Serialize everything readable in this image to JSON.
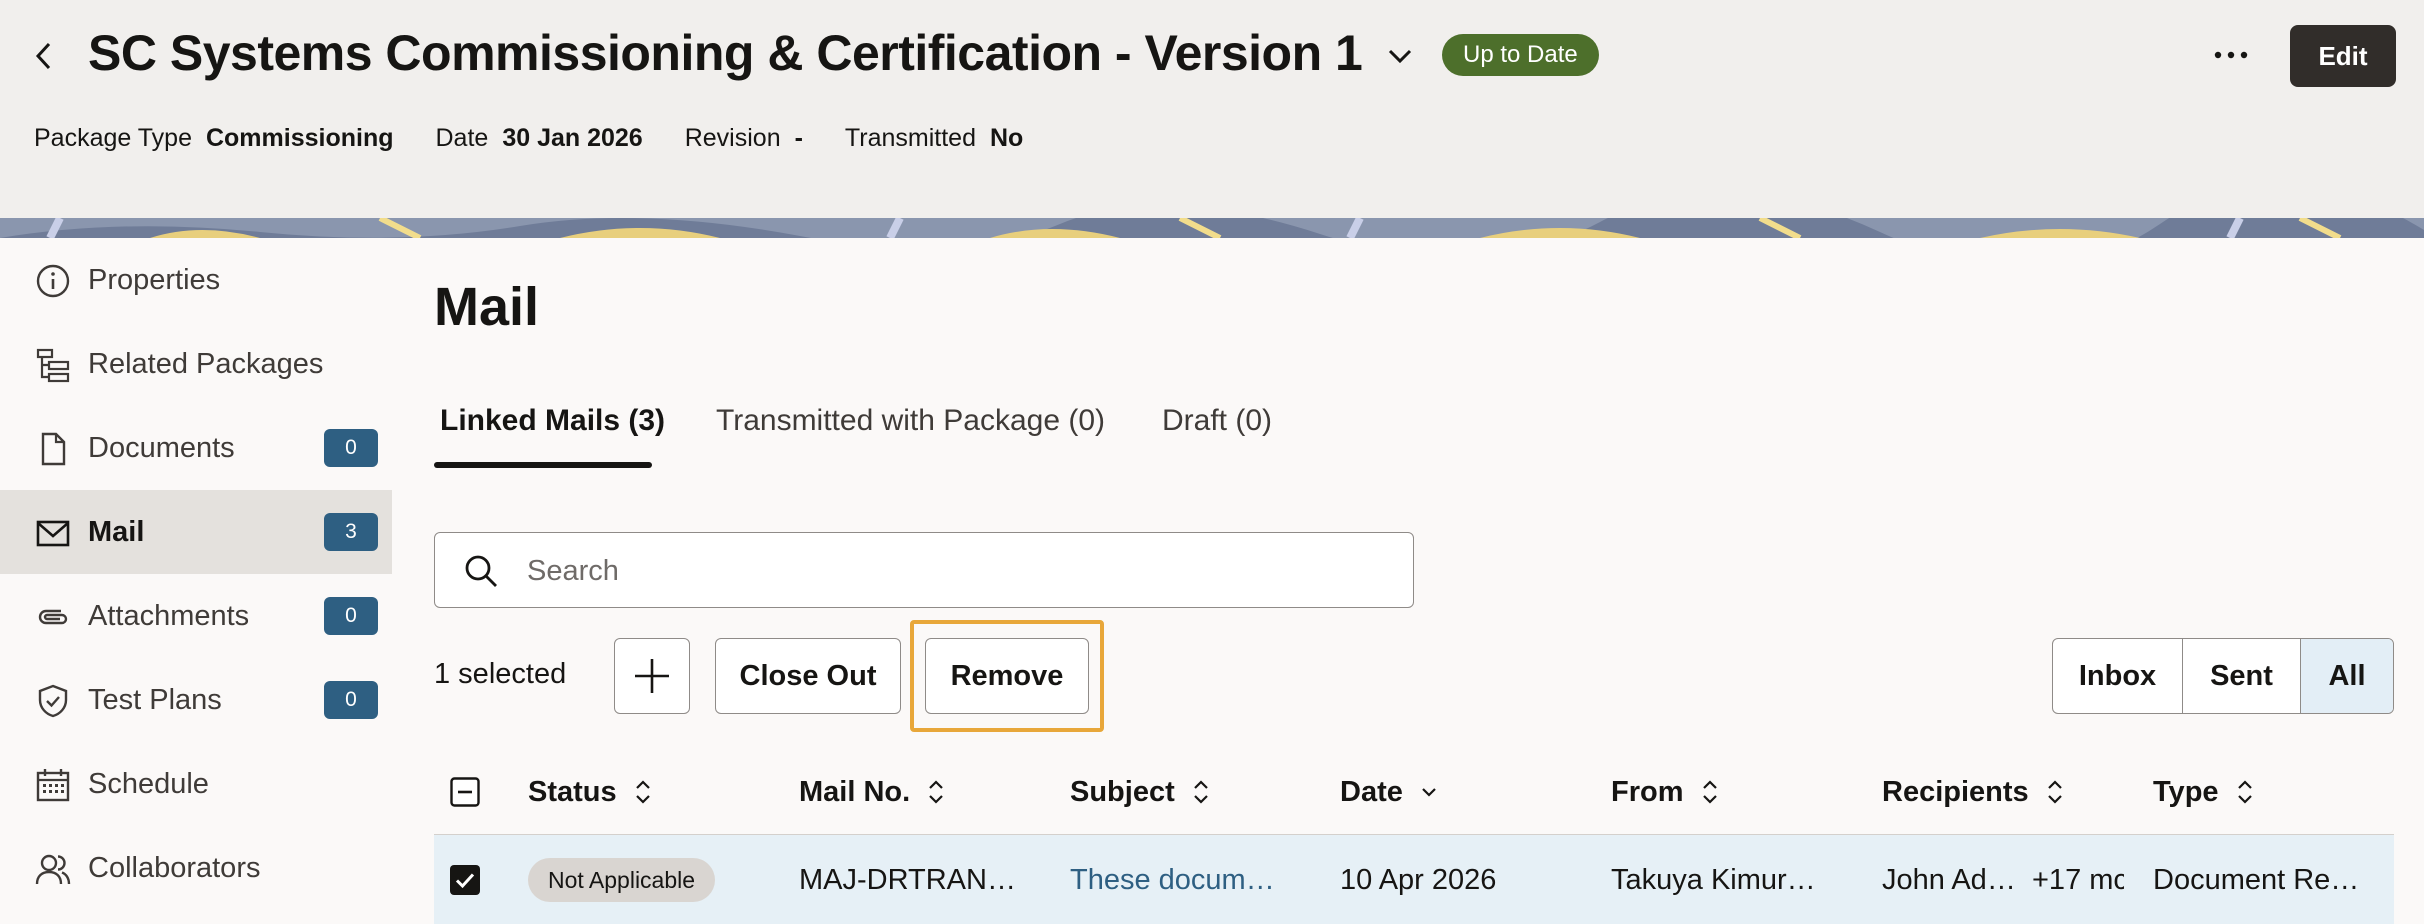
{
  "header": {
    "title": "SC Systems Commissioning & Certification - Version 1",
    "status": "Up to Date",
    "edit_label": "Edit",
    "meta": [
      {
        "label": "Package Type",
        "value": "Commissioning"
      },
      {
        "label": "Date",
        "value": "30 Jan 2026"
      },
      {
        "label": "Revision",
        "value": "-"
      },
      {
        "label": "Transmitted",
        "value": "No"
      }
    ]
  },
  "sidebar": {
    "items": [
      {
        "label": "Properties",
        "icon": "info-icon"
      },
      {
        "label": "Related Packages",
        "icon": "hierarchy-icon"
      },
      {
        "label": "Documents",
        "icon": "document-icon",
        "badge": "0"
      },
      {
        "label": "Mail",
        "icon": "mail-icon",
        "badge": "3",
        "active": true
      },
      {
        "label": "Attachments",
        "icon": "paperclip-icon",
        "badge": "0"
      },
      {
        "label": "Test Plans",
        "icon": "shield-check-icon",
        "badge": "0"
      },
      {
        "label": "Schedule",
        "icon": "calendar-icon"
      },
      {
        "label": "Collaborators",
        "icon": "users-icon"
      }
    ]
  },
  "main": {
    "title": "Mail",
    "tabs": [
      {
        "label": "Linked Mails (3)",
        "active": true
      },
      {
        "label": "Transmitted with Package (0)"
      },
      {
        "label": "Draft (0)"
      }
    ],
    "search": {
      "placeholder": "Search"
    },
    "toolbar": {
      "selected": "1 selected",
      "close_out": "Close Out",
      "remove": "Remove",
      "filters": [
        "Inbox",
        "Sent",
        "All"
      ],
      "active_filter": "All"
    },
    "table": {
      "columns": [
        "Status",
        "Mail No.",
        "Subject",
        "Date",
        "From",
        "Recipients",
        "Type"
      ],
      "rows": [
        {
          "checked": true,
          "status": "Not Applicable",
          "mail_no": "MAJ-DRTRAN…",
          "subject": "These docum…",
          "date": "10 Apr 2026",
          "from": "Takuya Kimur…",
          "recipients": "John Ad…",
          "recipients_more": "+17 mc",
          "type": "Document Re…"
        }
      ]
    }
  },
  "colors": {
    "accent": "#2e5f82",
    "status_green": "#4d6f2b",
    "focus": "#e8a73a",
    "dark_button": "#312d2a"
  }
}
